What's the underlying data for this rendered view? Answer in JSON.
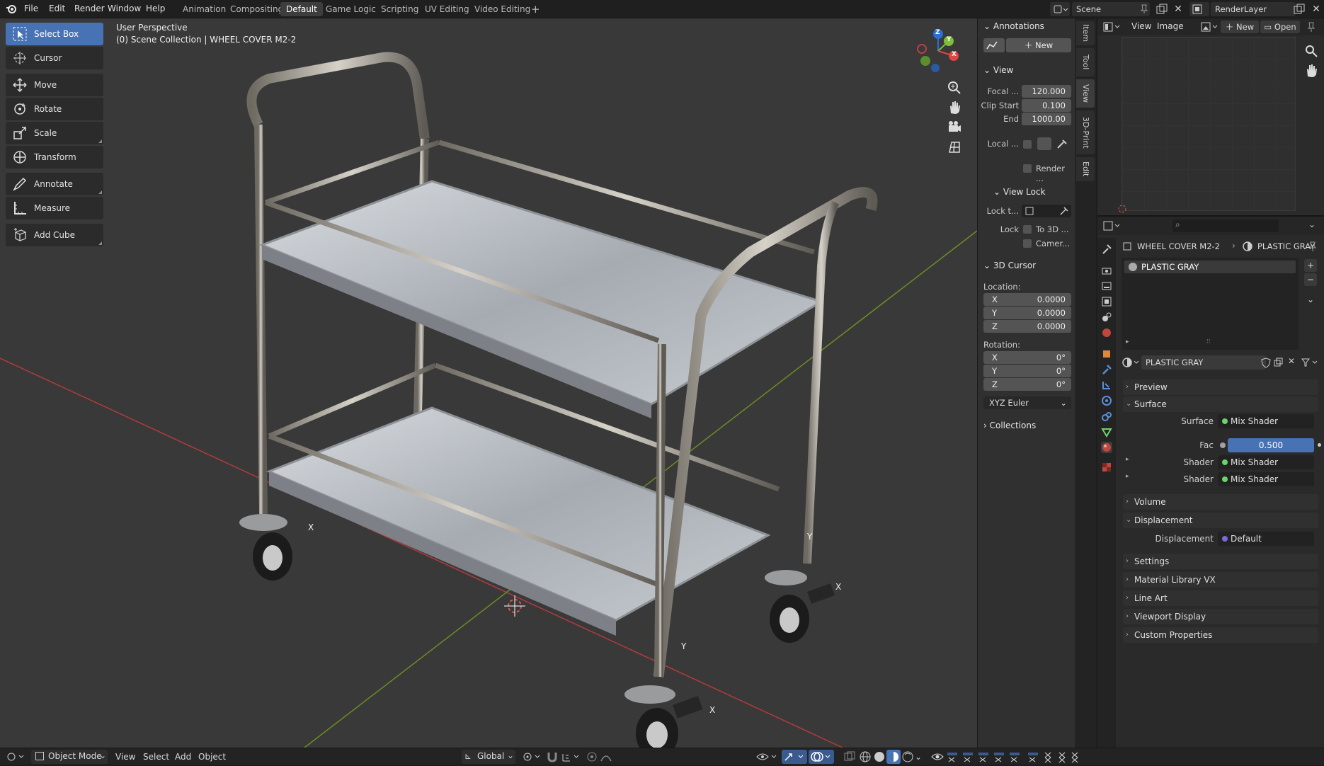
{
  "menus": [
    "File",
    "Edit",
    "Render",
    "Window",
    "Help"
  ],
  "workspaces": [
    "Animation",
    "Compositing",
    "Default",
    "Game Logic",
    "Scripting",
    "UV Editing",
    "Video Editing"
  ],
  "active_workspace": "Default",
  "add_workspace": "+",
  "scene": {
    "name": "Scene",
    "view_layer": "RenderLayer"
  },
  "toolbar": [
    {
      "label": "Select Box",
      "icon": "select-box-icon",
      "active": true
    },
    {
      "label": "Cursor",
      "icon": "cursor-icon"
    },
    {
      "label": "Move",
      "icon": "move-icon"
    },
    {
      "label": "Rotate",
      "icon": "rotate-icon"
    },
    {
      "label": "Scale",
      "icon": "scale-icon"
    },
    {
      "label": "Transform",
      "icon": "transform-icon"
    },
    {
      "label": "Annotate",
      "icon": "annotate-icon"
    },
    {
      "label": "Measure",
      "icon": "measure-icon"
    },
    {
      "label": "Add Cube",
      "icon": "add-cube-icon"
    }
  ],
  "viewport": {
    "perspective": "User Perspective",
    "collection": "(0) Scene Collection | WHEEL COVER M2-2",
    "gizmo_axes": [
      "X",
      "Y",
      "Z"
    ],
    "caster_labels": [
      "X",
      "Y",
      "X",
      "Y",
      "X"
    ]
  },
  "npanel": {
    "annotations": {
      "title": "Annotations",
      "new_label": "New"
    },
    "view": {
      "title": "View",
      "focal_label": "Focal ...",
      "focal": "120.000",
      "clip_start_label": "Clip Start",
      "clip_start": "0.100",
      "end_label": "End",
      "end": "1000.00",
      "local_label": "Local ...",
      "render_label": "Render ..."
    },
    "view_lock": {
      "title": "View Lock",
      "lock_to_label": "Lock t...",
      "lock_label": "Lock",
      "to3d_label": "To 3D ...",
      "camera_label": "Camer..."
    },
    "cursor": {
      "title": "3D Cursor",
      "location_label": "Location:",
      "loc": [
        {
          "axis": "X",
          "value": "0.0000"
        },
        {
          "axis": "Y",
          "value": "0.0000"
        },
        {
          "axis": "Z",
          "value": "0.0000"
        }
      ],
      "rotation_label": "Rotation:",
      "rot": [
        {
          "axis": "X",
          "value": "0°"
        },
        {
          "axis": "Y",
          "value": "0°"
        },
        {
          "axis": "Z",
          "value": "0°"
        }
      ],
      "mode": "XYZ Euler"
    },
    "collections": {
      "title": "Collections"
    }
  },
  "side_tabs": [
    "Item",
    "Tool",
    "View",
    "3D-Print",
    "Edit"
  ],
  "image_editor": {
    "menus": [
      "View",
      "Image"
    ],
    "new_label": "New",
    "open_label": "Open"
  },
  "properties": {
    "breadcrumb_object": "WHEEL COVER M2-2",
    "breadcrumb_material": "PLASTIC GRAY",
    "slot_name": "PLASTIC GRAY",
    "material_name": "PLASTIC GRAY",
    "sections": {
      "preview": "Preview",
      "surface": "Surface",
      "volume": "Volume",
      "displacement": "Displacement",
      "settings": "Settings",
      "material_library": "Material Library VX",
      "line_art": "Line Art",
      "viewport_display": "Viewport Display",
      "custom_properties": "Custom Properties"
    },
    "surface_rows": [
      {
        "label": "Surface",
        "value": "Mix Shader"
      },
      {
        "label": "Fac",
        "value": "0.500"
      },
      {
        "label": "Shader",
        "value": "Mix Shader"
      },
      {
        "label": "Shader",
        "value": "Mix Shader"
      }
    ],
    "displacement_row": {
      "label": "Displacement",
      "value": "Default"
    }
  },
  "statusbar": {
    "mode": "Object Mode",
    "menus": [
      "View",
      "Select",
      "Add",
      "Object"
    ],
    "orientation": "Global"
  },
  "colors": {
    "accent": "#4772b3",
    "viewport_bg": "#393939",
    "panel_bg": "#303030",
    "grid_x": "#b23b3b",
    "grid_y": "#6b8e23"
  }
}
